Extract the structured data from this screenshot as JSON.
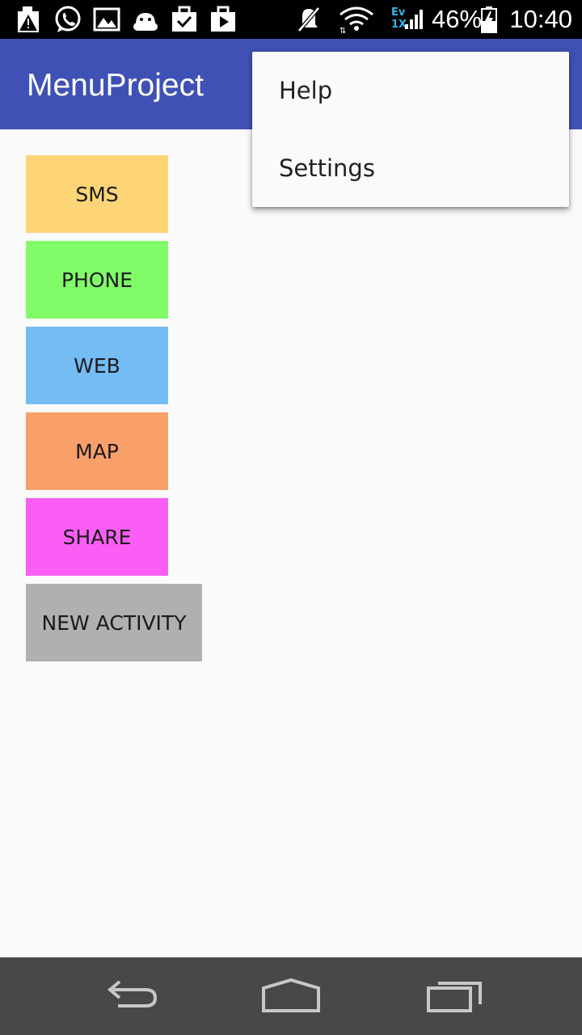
{
  "status_bar": {
    "battery_percent": "46%",
    "time": "10:40",
    "network_top": "Ev",
    "network_bottom": "1X",
    "icons": [
      "alert-icon",
      "whatsapp-icon",
      "gallery-icon",
      "android-icon",
      "task-check-icon",
      "play-store-icon",
      "mute-icon",
      "wifi-icon",
      "signal-icon",
      "battery-icon"
    ]
  },
  "app_bar": {
    "title": "MenuProject"
  },
  "buttons": [
    {
      "label": "SMS",
      "color": "#fdd476"
    },
    {
      "label": "PHONE",
      "color": "#80fc68"
    },
    {
      "label": "WEB",
      "color": "#74bcf4"
    },
    {
      "label": "MAP",
      "color": "#f99f69"
    },
    {
      "label": "SHARE",
      "color": "#fb5ef5"
    },
    {
      "label": "NEW ACTIVITY",
      "color": "#b0b0b0"
    }
  ],
  "overflow_menu": {
    "items": [
      {
        "label": "Help"
      },
      {
        "label": "Settings"
      }
    ]
  },
  "nav_bar": {
    "icons": [
      "back-icon",
      "home-icon",
      "recents-icon"
    ]
  },
  "colors": {
    "primary": "#3f51b5",
    "status_bar": "#000000",
    "nav_bar": "#48484a",
    "background": "#fafafa"
  }
}
